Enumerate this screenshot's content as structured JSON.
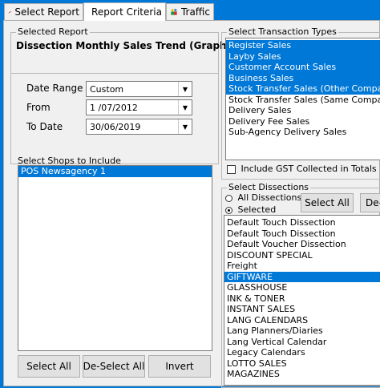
{
  "tabs": [
    {
      "label": "Select Report",
      "icon": "pin-icon"
    },
    {
      "label": "Report Criteria",
      "icon": "network-icon"
    },
    {
      "label": "Traffic",
      "icon": "traffic-people-icon"
    }
  ],
  "selected_report": {
    "group_title": "Selected Report",
    "name": "Dissection Monthly Sales Trend (Graph)"
  },
  "date": {
    "range_label": "Date Range",
    "range_value": "Custom",
    "from_label": "From",
    "from_value": "1 /07/2012",
    "to_label": "To Date",
    "to_value": "30/06/2019"
  },
  "shops": {
    "label": "Select Shops to Include",
    "items": [
      "POS Newsagency 1"
    ],
    "select_all": "Select All",
    "deselect_all": "De-Select All",
    "invert": "Invert"
  },
  "transaction_types": {
    "group_title": "Select Transaction Types",
    "items": [
      {
        "label": "Register Sales",
        "selected": true
      },
      {
        "label": "Layby Sales",
        "selected": true
      },
      {
        "label": "Customer Account Sales",
        "selected": true
      },
      {
        "label": "Business Sales",
        "selected": true
      },
      {
        "label": "Stock Transfer Sales (Other Company)",
        "selected": true
      },
      {
        "label": "Stock Transfer Sales (Same Company)",
        "selected": false
      },
      {
        "label": "Delivery Sales",
        "selected": false
      },
      {
        "label": "Delivery Fee Sales",
        "selected": false
      },
      {
        "label": "Sub-Agency Delivery Sales",
        "selected": false
      }
    ],
    "gst_label": "Include GST Collected in Totals"
  },
  "dissections": {
    "group_title": "Select Dissections",
    "all_label": "All Dissections",
    "selected_label": "Selected",
    "select_all": "Select All",
    "deselect": "De-",
    "items": [
      {
        "label": "Default Touch Dissection",
        "selected": false
      },
      {
        "label": "Default Touch Dissection",
        "selected": false
      },
      {
        "label": "Default Voucher Dissection",
        "selected": false
      },
      {
        "label": "DISCOUNT SPECIAL",
        "selected": false
      },
      {
        "label": "Freight",
        "selected": false
      },
      {
        "label": "GIFTWARE",
        "selected": true
      },
      {
        "label": "GLASSHOUSE",
        "selected": false
      },
      {
        "label": "INK & TONER",
        "selected": false
      },
      {
        "label": "INSTANT SALES",
        "selected": false
      },
      {
        "label": "LANG CALENDARS",
        "selected": false
      },
      {
        "label": "Lang Planners/Diaries",
        "selected": false
      },
      {
        "label": "Lang Vertical Calendar",
        "selected": false
      },
      {
        "label": "Legacy Calendars",
        "selected": false
      },
      {
        "label": "LOTTO SALES",
        "selected": false
      },
      {
        "label": "MAGAZINES",
        "selected": false
      }
    ]
  }
}
